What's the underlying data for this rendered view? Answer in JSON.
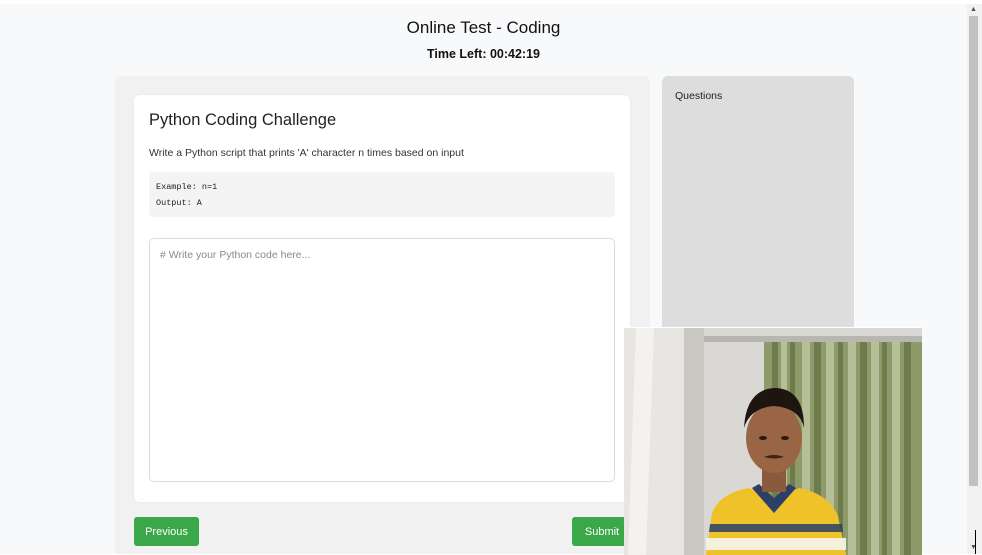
{
  "header": {
    "title": "Online Test - Coding",
    "timer": "Time Left: 00:42:19"
  },
  "question": {
    "title": "Python Coding Challenge",
    "description": "Write a Python script that prints 'A' character n times based on input",
    "example_lines": [
      "Example: n=1",
      "Output: A"
    ]
  },
  "editor": {
    "placeholder": "# Write your Python code here...",
    "value": ""
  },
  "buttons": {
    "previous": "Previous",
    "submit": "Submit"
  },
  "sidebar": {
    "title": "Questions"
  },
  "colors": {
    "button_green": "#3aa848",
    "page_background": "#f8f9fa",
    "questions_panel": "#dddddd"
  },
  "icons": {
    "scroll_up": "chevron-up-icon",
    "scroll_down": "chevron-down-icon"
  }
}
